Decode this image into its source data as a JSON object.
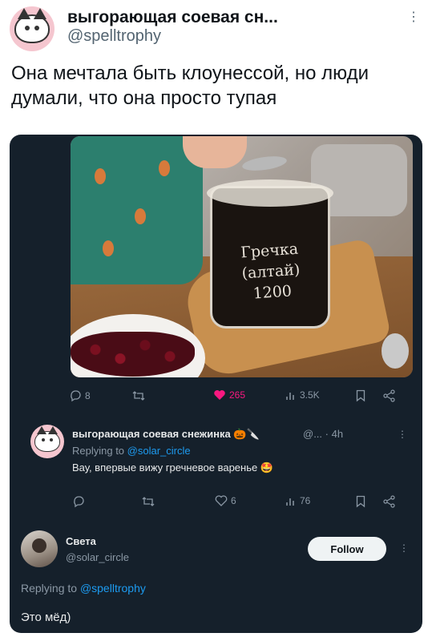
{
  "tweet": {
    "author_name": "выгорающая соевая сн...",
    "author_handle": "@spelltrophy",
    "text": "Она мечтала быть клоунессой, но люди думали, что она просто тупая"
  },
  "quoted": {
    "photo_label_lines": [
      "Гречка",
      "(алтай)",
      "1200"
    ],
    "actions": {
      "replies": "8",
      "retweets": "",
      "likes": "265",
      "views": "3.5K"
    },
    "reply": {
      "author_name": "выгорающая соевая снежинка 🎃🔪",
      "meta": "@... · 4h",
      "replying_prefix": "Replying to ",
      "replying_handle": "@solar_circle",
      "text": "Вау, впервые вижу гречневое варенье 🤩",
      "actions": {
        "replies": "",
        "retweets": "",
        "likes": "6",
        "views": "76"
      }
    },
    "follow_card": {
      "name": "Света",
      "handle": "@solar_circle",
      "follow_label": "Follow",
      "replying_prefix": "Replying to ",
      "replying_handle": "@spelltrophy",
      "text": "Это мёд)"
    }
  },
  "colors": {
    "dark_bg": "#15202b",
    "like_pink": "#f91880",
    "link_blue": "#1d9bf0",
    "muted": "#8b98a5"
  }
}
